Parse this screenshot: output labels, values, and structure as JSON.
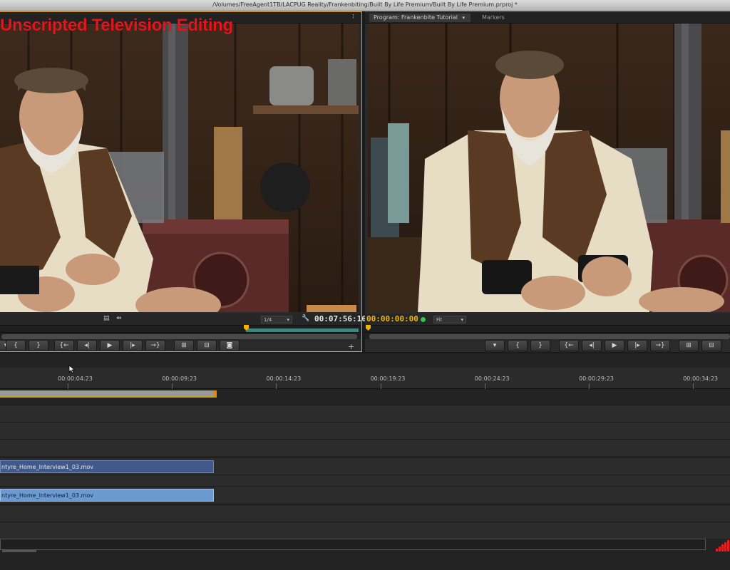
{
  "window": {
    "title": "/Volumes/FreeAgent1TB/LACPUG Reality/Frankenbiting/Built By Life Premium/Built By Life Premium.prproj *"
  },
  "overlay": {
    "title": "Unscripted Television Editing",
    "color": "#e0161d"
  },
  "source_monitor": {
    "timecode": "00:07:56:16",
    "resolution": "1/4",
    "tab_arrow": "▾"
  },
  "program_monitor": {
    "tab_label": "Program: Frankenbite Tutorial",
    "tab_markers": "Markers",
    "timecode": "00:00:00:00",
    "zoom": "Fit"
  },
  "timeline": {
    "ruler_labels": [
      "00:00:04:23",
      "00:00:09:23",
      "00:00:14:23",
      "00:00:19:23",
      "00:00:24:23",
      "00:00:29:23",
      "00:00:34:23"
    ],
    "video_clip": "ntyre_Home_Interview1_03.mov",
    "audio_clip": "ntyre_Home_Interview1_03.mov"
  },
  "colors": {
    "accent_in_out": "#2f8a8a",
    "timecode_yellow": "#f0b400",
    "panel_focus": "#e0a020",
    "video_clip": "#40598a",
    "audio_clip": "#6a9ad0",
    "meter": "#e02020"
  }
}
